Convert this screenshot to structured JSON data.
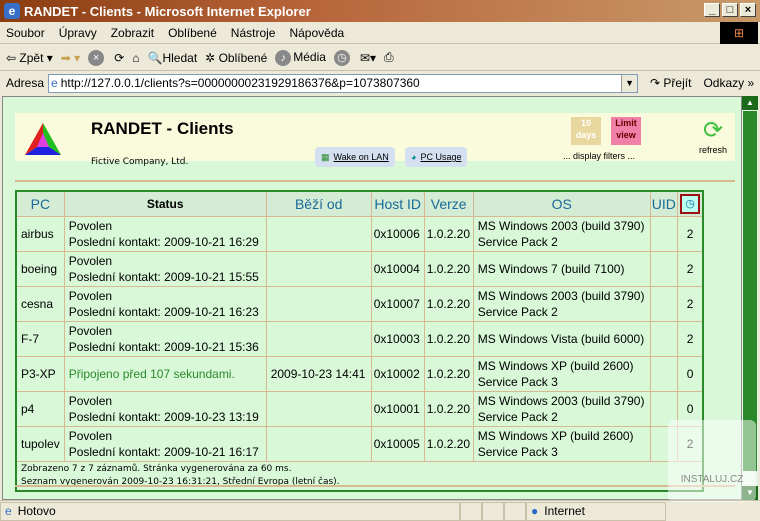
{
  "window": {
    "title": "RANDET - Clients - Microsoft Internet Explorer"
  },
  "menu": [
    "Soubor",
    "Úpravy",
    "Zobrazit",
    "Oblíbené",
    "Nástroje",
    "Nápověda"
  ],
  "toolbar": {
    "back": "Zpět",
    "search": "Hledat",
    "favorites": "Oblíbené",
    "media": "Média"
  },
  "address": {
    "label": "Adresa",
    "url": "http://127.0.0.1/clients?s=00000000231929186376&p=1073807360",
    "go": "Přejít",
    "links": "Odkazy"
  },
  "page": {
    "title": "RANDET - Clients",
    "company": "Fictive Company, Ltd.",
    "wake": "Wake on LAN",
    "usage": "PC Usage",
    "days_filter": "10 days",
    "limit_filter": "Limit view",
    "filters_label": "... display filters ...",
    "refresh": "refresh"
  },
  "table": {
    "headers": [
      "PC",
      "Status",
      "Běží od",
      "Host ID",
      "Verze",
      "OS",
      "UID"
    ],
    "rows": [
      {
        "pc": "airbus",
        "s1": "Povolen",
        "s2": "Poslední kontakt: 2009-10-21 16:29",
        "since": "",
        "host": "0x10006",
        "ver": "1.0.2.20",
        "os1": "MS Windows 2003 (build 3790)",
        "os2": "Service Pack 2",
        "uid": "",
        "n": "2"
      },
      {
        "pc": "boeing",
        "s1": "Povolen",
        "s2": "Poslední kontakt: 2009-10-21 15:55",
        "since": "",
        "host": "0x10004",
        "ver": "1.0.2.20",
        "os1": "MS Windows 7 (build 7100)",
        "os2": "",
        "uid": "",
        "n": "2"
      },
      {
        "pc": "cesna",
        "s1": "Povolen",
        "s2": "Poslední kontakt: 2009-10-21 16:23",
        "since": "",
        "host": "0x10007",
        "ver": "1.0.2.20",
        "os1": "MS Windows 2003 (build 3790)",
        "os2": "Service Pack 2",
        "uid": "",
        "n": "2"
      },
      {
        "pc": "F-7",
        "s1": "Povolen",
        "s2": "Poslední kontakt: 2009-10-21 15:36",
        "since": "",
        "host": "0x10003",
        "ver": "1.0.2.20",
        "os1": "MS Windows Vista (build 6000)",
        "os2": "",
        "uid": "",
        "n": "2"
      },
      {
        "pc": "P3-XP",
        "s1": "Připojeno před 107 sekundami.",
        "s2": "",
        "since": "2009-10-23 14:41",
        "host": "0x10002",
        "ver": "1.0.2.20",
        "os1": "MS Windows XP (build 2600)",
        "os2": "Service Pack 3",
        "uid": "",
        "n": "0"
      },
      {
        "pc": "p4",
        "s1": "Povolen",
        "s2": "Poslední kontakt: 2009-10-23 13:19",
        "since": "",
        "host": "0x10001",
        "ver": "1.0.2.20",
        "os1": "MS Windows 2003 (build 3790)",
        "os2": "Service Pack 2",
        "uid": "",
        "n": "0"
      },
      {
        "pc": "tupolev",
        "s1": "Povolen",
        "s2": "Poslední kontakt: 2009-10-21 16:17",
        "since": "",
        "host": "0x10005",
        "ver": "1.0.2.20",
        "os1": "MS Windows XP (build 2600)",
        "os2": "Service Pack 3",
        "uid": "",
        "n": "2"
      }
    ],
    "footer1": "Zobrazeno 7 z 7 záznamů. Stránka vygenerována za 60 ms.",
    "footer2": "Seznam vygenerován 2009-10-23 16:31:21, Střední Evropa (letní čas)."
  },
  "statusbar": {
    "text": "Hotovo",
    "zone": "Internet"
  },
  "watermark": "INSTALUJ.CZ"
}
